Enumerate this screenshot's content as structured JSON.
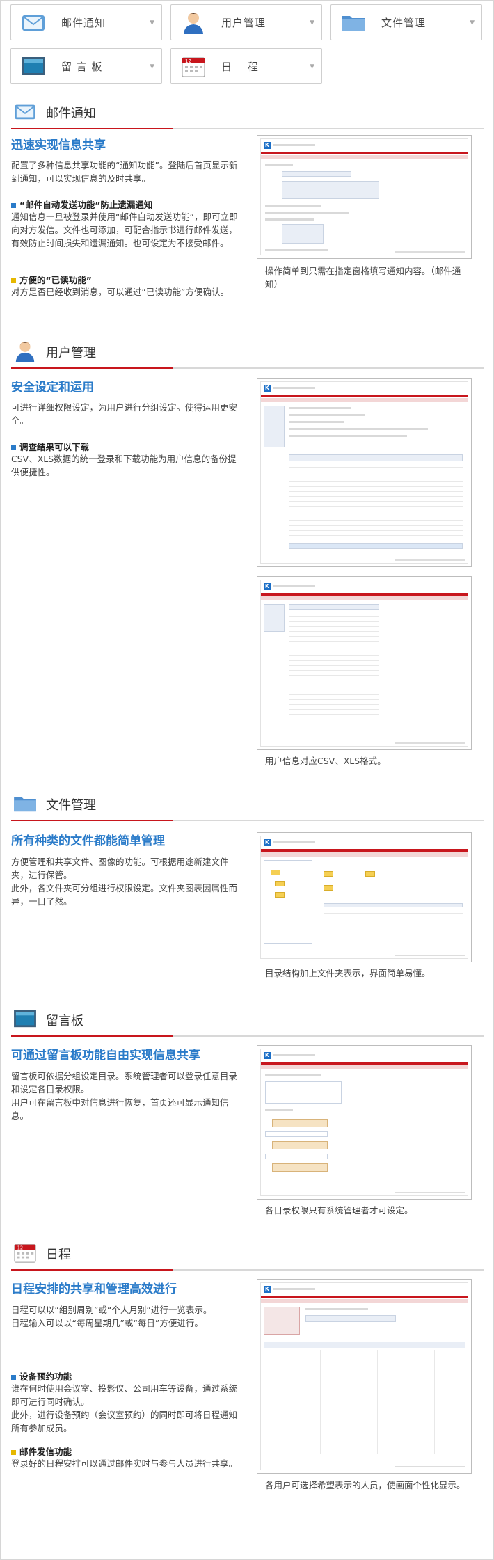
{
  "nav": [
    {
      "label": "邮件通知",
      "icon": "mail-icon"
    },
    {
      "label": "用户管理",
      "icon": "user-icon"
    },
    {
      "label": "文件管理",
      "icon": "folder-icon"
    },
    {
      "label": "留 言 板",
      "icon": "board-icon"
    },
    {
      "label": "日　 程",
      "icon": "calendar-icon"
    }
  ],
  "sections": {
    "mail": {
      "title": "邮件通知",
      "heading": "迅速实现信息共享",
      "body": "配置了多种信息共享功能的“通知功能”。登陆后首页显示新到通知，可以实现信息的及时共享。",
      "sub1": "“邮件自动发送功能”防止遗漏通知",
      "sub1_body": "通知信息一旦被登录并使用“邮件自动发送功能”，即可立即向对方发信。文件也可添加，可配合指示书进行邮件发送，有效防止时间损失和遗漏通知。也可设定为不接受邮件。",
      "sub2": "方便的“已读功能”",
      "sub2_body": "对方是否已经收到消息，可以通过“已读功能”方便确认。",
      "caption": "操作简单到只需在指定窗格填写通知内容。（邮件通知）"
    },
    "user": {
      "title": "用户管理",
      "heading": "安全设定和运用",
      "body": "可进行详细权限设定，为用户进行分组设定。使得运用更安全。",
      "sub1": "调查结果可以下载",
      "sub1_body": "CSV、XLS数据的统一登录和下载功能为用户信息的备份提供便捷性。",
      "caption": "用户信息对应CSV、XLS格式。"
    },
    "file": {
      "title": "文件管理",
      "heading": "所有种类的文件都能简单管理",
      "body": "方便管理和共享文件、图像的功能。可根据用途新建文件夹，进行保管。\n此外，各文件夹可分组进行权限设定。文件夹图表因属性而异，一目了然。",
      "caption": "目录结构加上文件夹表示，界面简单易懂。"
    },
    "board": {
      "title": "留言板",
      "heading": "可通过留言板功能自由实现信息共享",
      "body": "留言板可依据分组设定目录。系统管理者可以登录任意目录和设定各目录权限。\n用户可在留言板中对信息进行恢复，首页还可显示通知信息。",
      "caption": "各目录权限只有系统管理者才可设定。"
    },
    "schedule": {
      "title": "日程",
      "heading": "日程安排的共享和管理高效进行",
      "body": "日程可以以“组别周别”或“个人月别”进行一览表示。\n日程输入可以以“每周星期几”或“每日”方便进行。",
      "sub1": "设备预约功能",
      "sub1_body": "谁在何时使用会议室、投影仪、公司用车等设备，通过系统即可进行同时确认。\n此外，进行设备预约（会议室预约）的同时即可将日程通知所有参加成员。",
      "sub2": "邮件发信功能",
      "sub2_body": "登录好的日程安排可以通过邮件实时与参与人员进行共享。",
      "caption": "各用户可选择希望表示的人员，使画面个性化显示。"
    }
  },
  "colors": {
    "accent": "#2a7bc9",
    "rule_red": "#c8161d",
    "square_yellow": "#e6b800",
    "square_blue": "#2a7bc9"
  }
}
